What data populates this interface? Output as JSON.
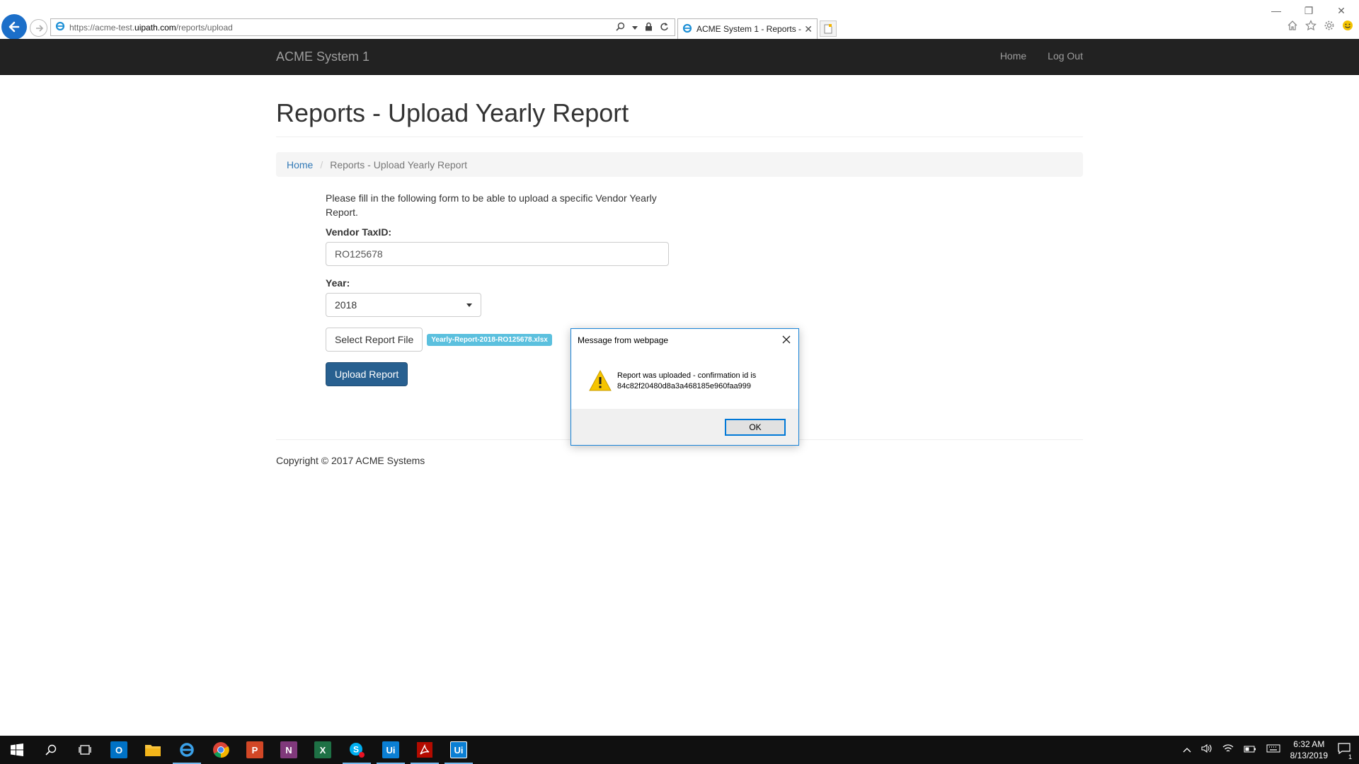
{
  "browser": {
    "url_prefix": "https://acme-test.",
    "url_domain": "uipath.com",
    "url_path": "/reports/upload",
    "tab_title": "ACME System 1 - Reports - ..."
  },
  "navbar": {
    "brand": "ACME System 1",
    "links": [
      "Home",
      "Log Out"
    ]
  },
  "page": {
    "title": "Reports - Upload Yearly Report",
    "breadcrumb": {
      "home": "Home",
      "current": "Reports - Upload Yearly Report"
    }
  },
  "form": {
    "intro": "Please fill in the following form to be able to upload a specific Vendor Yearly Report.",
    "vendor_label": "Vendor TaxID:",
    "vendor_value": "RO125678",
    "year_label": "Year:",
    "year_value": "2018",
    "select_file_label": "Select Report File",
    "selected_file": "Yearly-Report-2018-RO125678.xlsx",
    "upload_label": "Upload Report"
  },
  "footer": {
    "copyright": "Copyright © 2017 ACME Systems"
  },
  "dialog": {
    "title": "Message from webpage",
    "message_line1": "Report was uploaded - confirmation id is",
    "message_line2": "84c82f20480d8a3a468185e960faa999",
    "ok_label": "OK"
  },
  "taskbar": {
    "time": "6:32 AM",
    "date": "8/13/2019",
    "notification_count": "1"
  },
  "colors": {
    "navbar_bg": "#222222",
    "link": "#337ab7",
    "primary_button": "#286090",
    "file_badge": "#5bc0de",
    "dialog_border": "#1883d7"
  }
}
